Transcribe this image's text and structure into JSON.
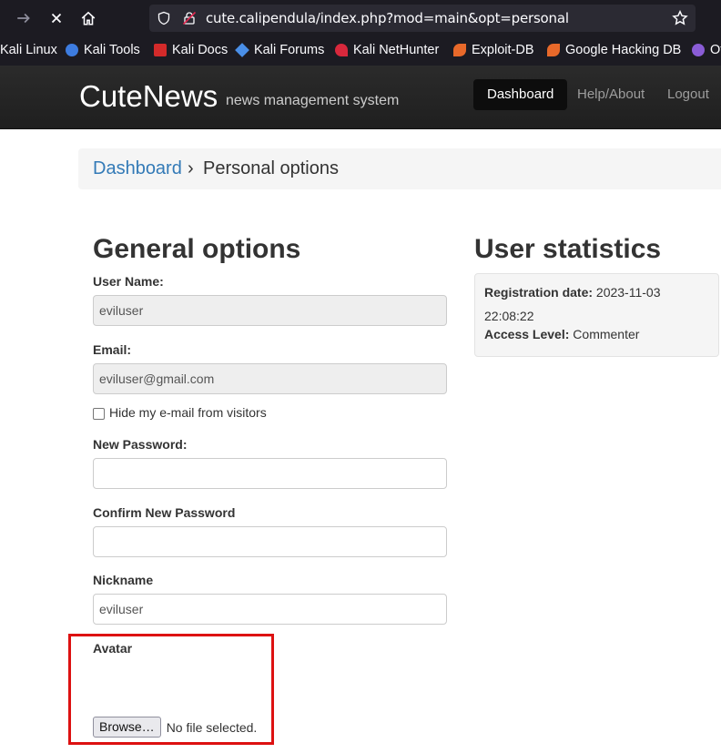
{
  "browser": {
    "url": "cute.calipendula/index.php?mod=main&opt=personal"
  },
  "bookmarks": [
    {
      "label": "Kali Linux",
      "icon": "kali-icon"
    },
    {
      "label": "Kali Tools",
      "icon": "kali-tools-icon"
    },
    {
      "label": "Kali Docs",
      "icon": "kali-docs-icon"
    },
    {
      "label": "Kali Forums",
      "icon": "kali-forums-icon"
    },
    {
      "label": "Kali NetHunter",
      "icon": "nethunter-icon"
    },
    {
      "label": "Exploit-DB",
      "icon": "exploit-db-icon"
    },
    {
      "label": "Google Hacking DB",
      "icon": "ghdb-icon"
    },
    {
      "label": "Of",
      "icon": "offsec-icon"
    }
  ],
  "header": {
    "brand": "CuteNews",
    "tagline": "news management system",
    "nav": {
      "dashboard": "Dashboard",
      "help": "Help/About",
      "logout": "Logout"
    }
  },
  "breadcrumb": {
    "link": "Dashboard",
    "separator": "›",
    "current": "Personal options"
  },
  "general": {
    "title": "General options",
    "username_label": "User Name:",
    "username_value": "eviluser",
    "email_label": "Email:",
    "email_value": "eviluser@gmail.com",
    "hide_email_label": "Hide my e-mail from visitors",
    "new_password_label": "New Password:",
    "confirm_password_label": "Confirm New Password",
    "nickname_label": "Nickname",
    "nickname_value": "eviluser",
    "avatar_label": "Avatar",
    "browse_label": "Browse…",
    "file_status": "No file selected."
  },
  "stats": {
    "title": "User statistics",
    "registration_label": "Registration date:",
    "registration_date": "2023-11-03",
    "registration_time": "22:08:22",
    "access_label": "Access Level:",
    "access_value": "Commenter"
  },
  "colors": {
    "link": "#337ab7",
    "highlight": "#dd1111"
  }
}
